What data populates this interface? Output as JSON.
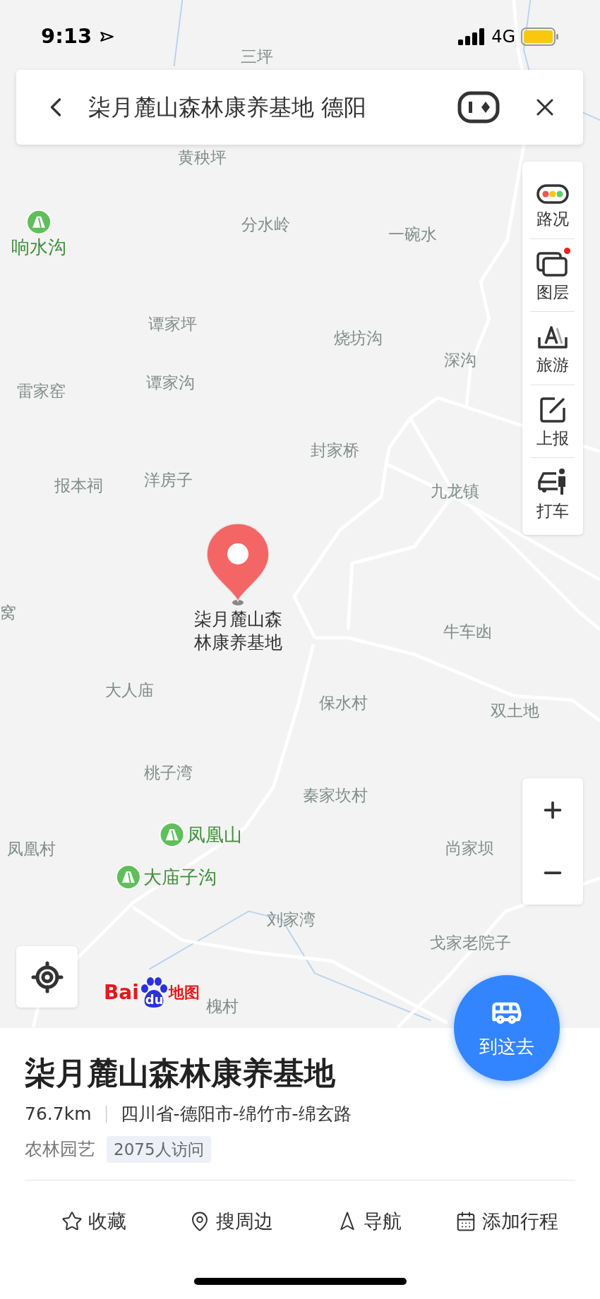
{
  "status_bar": {
    "time": "9:13",
    "network": "4G"
  },
  "search": {
    "query": "柒月麓山森林康养基地 德阳"
  },
  "map_tools": [
    {
      "kind": "traffic",
      "label": "路况",
      "badge": false
    },
    {
      "kind": "layers",
      "label": "图层",
      "badge": true
    },
    {
      "kind": "travel",
      "label": "旅游",
      "badge": false
    },
    {
      "kind": "report",
      "label": "上报",
      "badge": false
    },
    {
      "kind": "taxi",
      "label": "打车",
      "badge": false
    }
  ],
  "map": {
    "labels": [
      {
        "text": "三坪",
        "kind": "place"
      },
      {
        "text": "黄秧坪",
        "kind": "place"
      },
      {
        "text": "响水沟",
        "kind": "scenic"
      },
      {
        "text": "分水岭",
        "kind": "place"
      },
      {
        "text": "一碗水",
        "kind": "place"
      },
      {
        "text": "谭家坪",
        "kind": "place"
      },
      {
        "text": "烧坊沟",
        "kind": "place"
      },
      {
        "text": "深沟",
        "kind": "place"
      },
      {
        "text": "雷家窑",
        "kind": "place"
      },
      {
        "text": "谭家沟",
        "kind": "place"
      },
      {
        "text": "封家桥",
        "kind": "place"
      },
      {
        "text": "报本祠",
        "kind": "place"
      },
      {
        "text": "洋房子",
        "kind": "place"
      },
      {
        "text": "九龙镇",
        "kind": "place"
      },
      {
        "text": "窝",
        "kind": "place"
      },
      {
        "text": "牛车凼",
        "kind": "place"
      },
      {
        "text": "大人庙",
        "kind": "place"
      },
      {
        "text": "保水村",
        "kind": "place"
      },
      {
        "text": "双土地",
        "kind": "place"
      },
      {
        "text": "桃子湾",
        "kind": "place"
      },
      {
        "text": "秦家坎村",
        "kind": "place"
      },
      {
        "text": "凤凰山",
        "kind": "scenic"
      },
      {
        "text": "凤凰村",
        "kind": "place"
      },
      {
        "text": "尚家坝",
        "kind": "place"
      },
      {
        "text": "大庙子沟",
        "kind": "scenic"
      },
      {
        "text": "刘家湾",
        "kind": "place"
      },
      {
        "text": "戈家老院子",
        "kind": "place"
      },
      {
        "text": "槐村",
        "kind": "place"
      }
    ],
    "pin_label": "柒月麓山森林康养基地",
    "logo": [
      "Bai",
      "du",
      "地图"
    ]
  },
  "place": {
    "name": "柒月麓山森林康养基地",
    "distance": "76.7km",
    "address": "四川省-德阳市-绵竹市-绵玄路",
    "category": "农林园艺",
    "visits": "2075人访问"
  },
  "route_button": "到这去",
  "actions": [
    {
      "kind": "favorite",
      "label": "收藏"
    },
    {
      "kind": "nearby",
      "label": "搜周边"
    },
    {
      "kind": "navigate",
      "label": "导航"
    },
    {
      "kind": "itinerary",
      "label": "添加行程"
    }
  ]
}
